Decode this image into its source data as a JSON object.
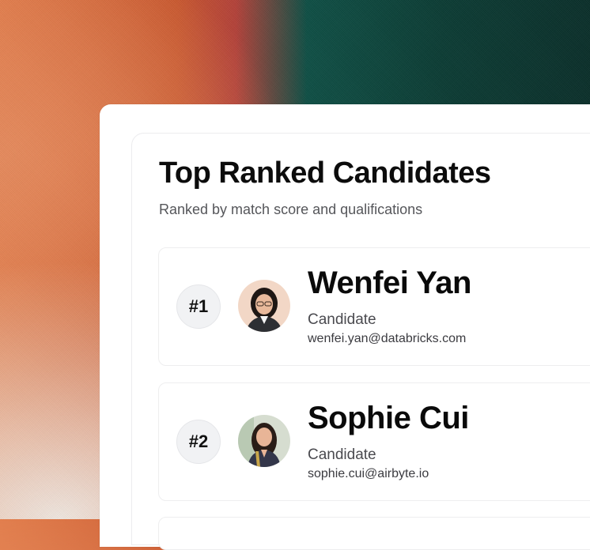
{
  "header": {
    "title": "Top Ranked Candidates",
    "subtitle": "Ranked by match score and qualifications"
  },
  "candidates": [
    {
      "rank": "#1",
      "name": "Wenfei Yan",
      "role": "Candidate",
      "email": "wenfei.yan@databricks.com"
    },
    {
      "rank": "#2",
      "name": "Sophie Cui",
      "role": "Candidate",
      "email": "sophie.cui@airbyte.io"
    }
  ],
  "colors": {
    "background_orange": "#e07a48",
    "background_green": "#0c3c34",
    "card_bg": "#ffffff",
    "rank_badge_bg": "#f1f2f4"
  }
}
